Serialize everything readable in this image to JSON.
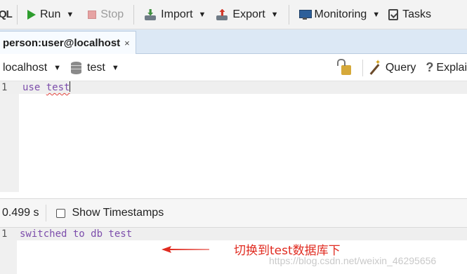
{
  "toolbar": {
    "cut_label": "QL",
    "run_label": "Run",
    "stop_label": "Stop",
    "import_label": "Import",
    "export_label": "Export",
    "monitoring_label": "Monitoring",
    "tasks_label": "Tasks"
  },
  "tab": {
    "label": "person:user@localhost",
    "close": "×"
  },
  "connection": {
    "server": "localhost",
    "database": "test",
    "query_label": "Query",
    "explain_label": "Explai"
  },
  "editor": {
    "line_number": "1",
    "keyword": "use",
    "argument": "test"
  },
  "results": {
    "elapsed": "0.499 s",
    "show_timestamps_label": "Show Timestamps",
    "show_timestamps_checked": false
  },
  "output": {
    "line_number": "1",
    "text": "switched to db test"
  },
  "annotation": {
    "text": "切换到test数据库下",
    "color": "#e02b20"
  },
  "watermark": "https://blog.csdn.net/weixin_46295656",
  "colors": {
    "tab_strip": "#dce8f5",
    "code_text": "#7c4dab",
    "run_green": "#2e9d2e"
  }
}
